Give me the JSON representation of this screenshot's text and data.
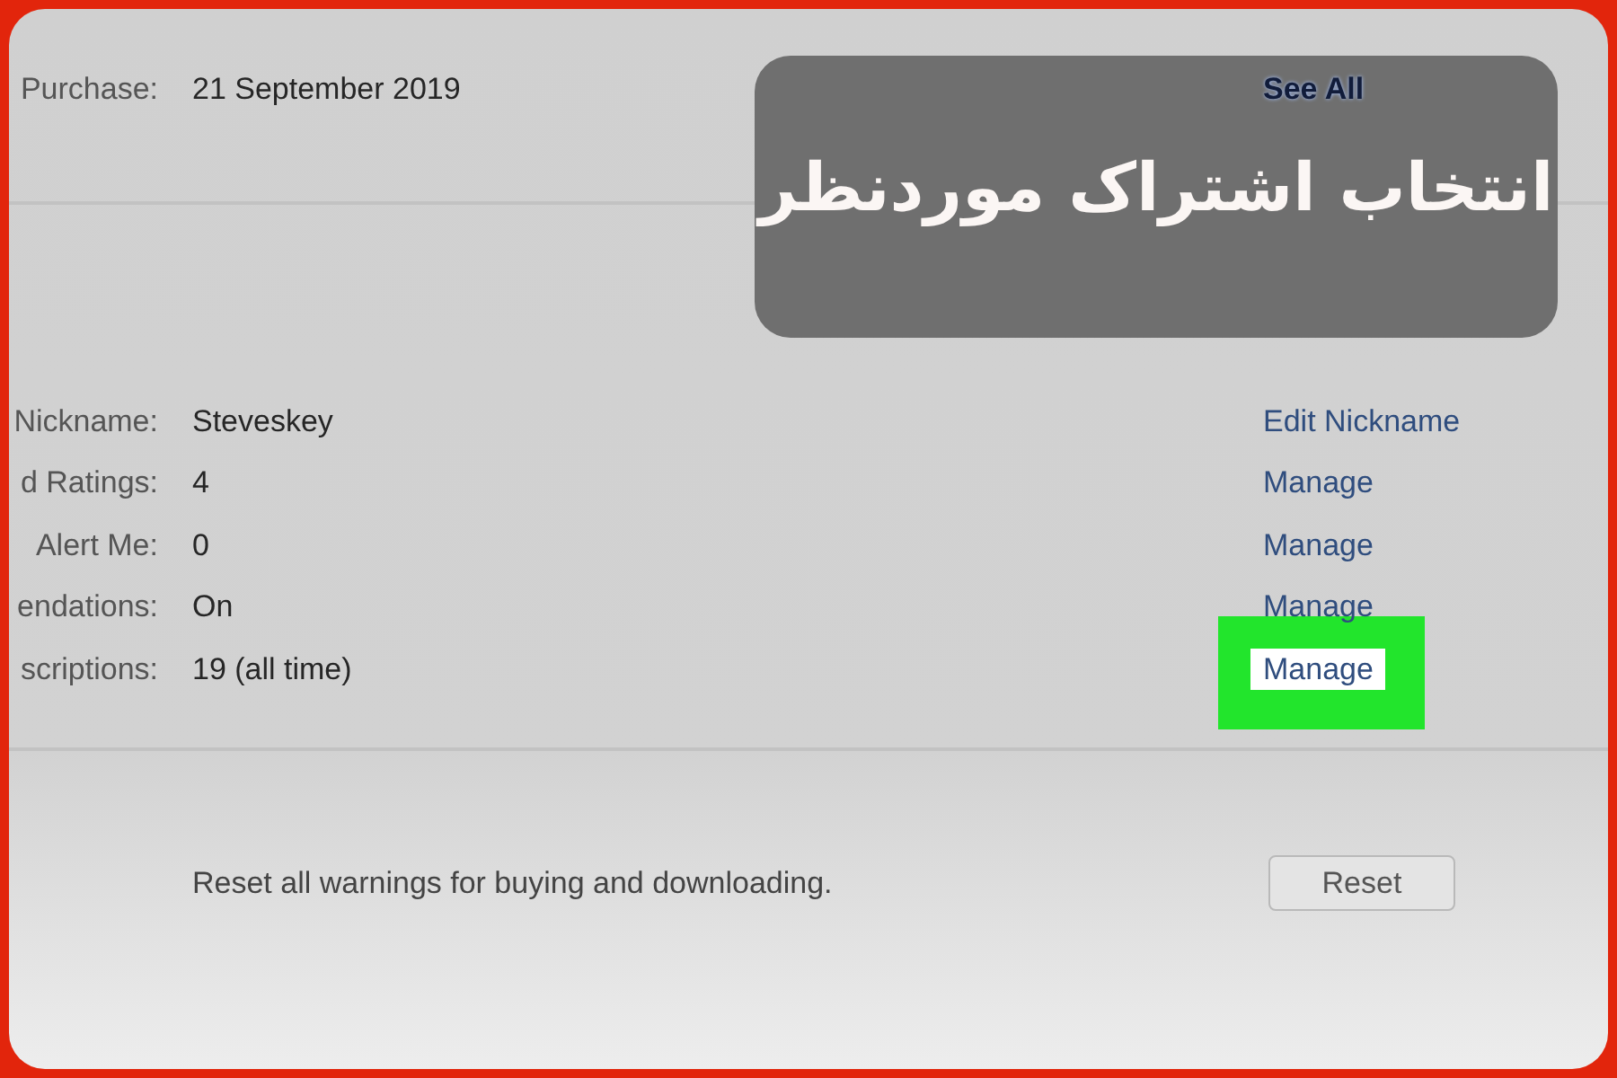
{
  "caption": "انتخاب اشتراک موردنظر",
  "purchase": {
    "label": "Purchase:",
    "value": "21 September 2019",
    "link": "See All"
  },
  "settings": [
    {
      "label": "Nickname:",
      "value": "Steveskey",
      "action": "Edit Nickname",
      "highlighted": false
    },
    {
      "label": "d Ratings:",
      "value": "4",
      "action": "Manage",
      "highlighted": false
    },
    {
      "label": "Alert Me:",
      "value": "0",
      "action": "Manage",
      "highlighted": false
    },
    {
      "label": "endations:",
      "value": "On",
      "action": "Manage",
      "highlighted": false
    },
    {
      "label": "scriptions:",
      "value": "19 (all time)",
      "action": "Manage",
      "highlighted": true
    }
  ],
  "reset": {
    "text": "Reset all warnings for buying and downloading.",
    "button": "Reset"
  }
}
